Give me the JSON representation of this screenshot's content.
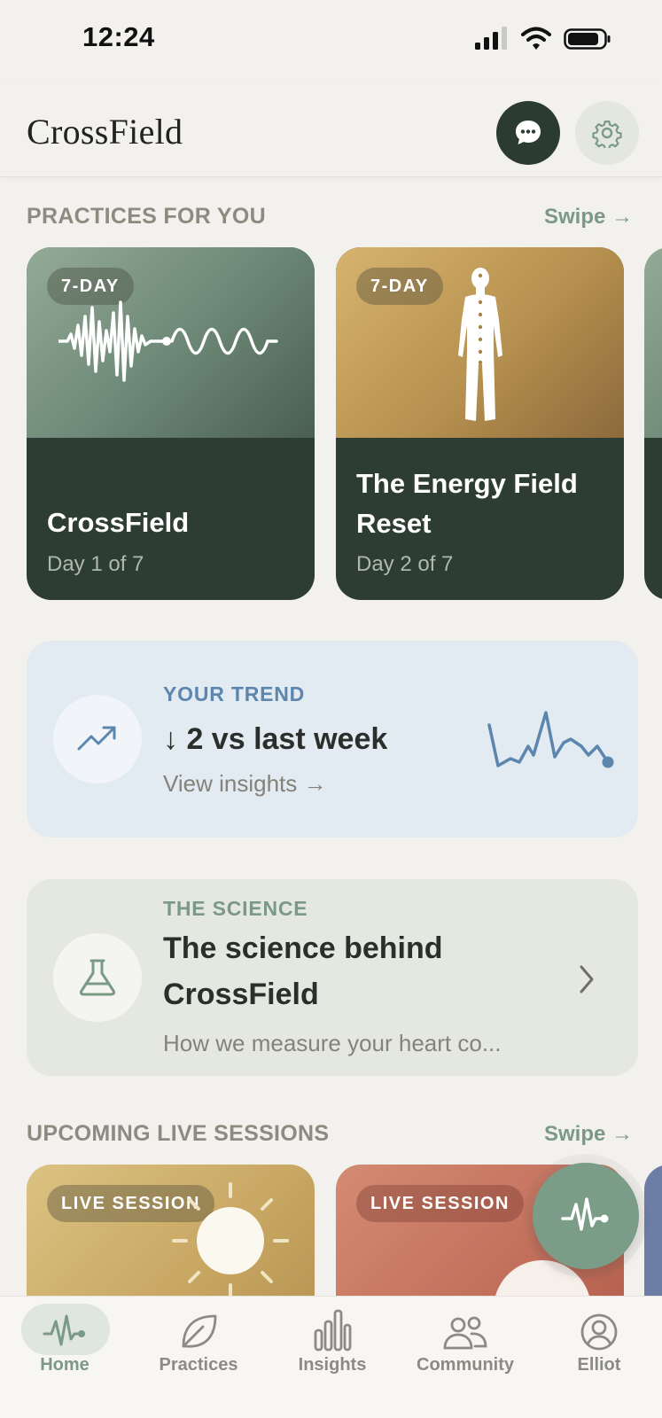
{
  "status_bar": {
    "time": "12:24"
  },
  "header": {
    "logo": "CrossField"
  },
  "practices": {
    "section_title": "PRACTICES FOR YOU",
    "swipe_label": "Swipe →",
    "cards": [
      {
        "badge": "7-DAY",
        "title": "CrossField",
        "subtitle": "Day 1 of 7"
      },
      {
        "badge": "7-DAY",
        "title": "The Energy Field Reset",
        "subtitle": "Day 2 of 7"
      }
    ]
  },
  "trend": {
    "eyebrow": "YOUR TREND",
    "headline": "↓ 2 vs last week",
    "link": "View insights →"
  },
  "science": {
    "eyebrow": "THE SCIENCE",
    "headline": "The science behind CrossField",
    "description": "How we measure your heart co..."
  },
  "live_sessions": {
    "section_title": "UPCOMING LIVE SESSIONS",
    "swipe_label": "Swipe →",
    "cards": [
      {
        "badge": "LIVE SESSION"
      },
      {
        "badge": "LIVE SESSION"
      }
    ]
  },
  "tabbar": {
    "items": [
      {
        "label": "Home",
        "icon": "pulse-icon",
        "active": true
      },
      {
        "label": "Practices",
        "icon": "leaf-icon",
        "active": false
      },
      {
        "label": "Insights",
        "icon": "bar-chart-icon",
        "active": false
      },
      {
        "label": "Community",
        "icon": "people-icon",
        "active": false
      },
      {
        "label": "Elliot",
        "icon": "profile-icon",
        "active": false
      }
    ]
  },
  "colors": {
    "background": "#f3f1ed",
    "accent_green": "#7b9c87",
    "dark_green": "#2e3d33",
    "trend_blue": "#5d86ae",
    "science_green": "#7a9a86"
  }
}
